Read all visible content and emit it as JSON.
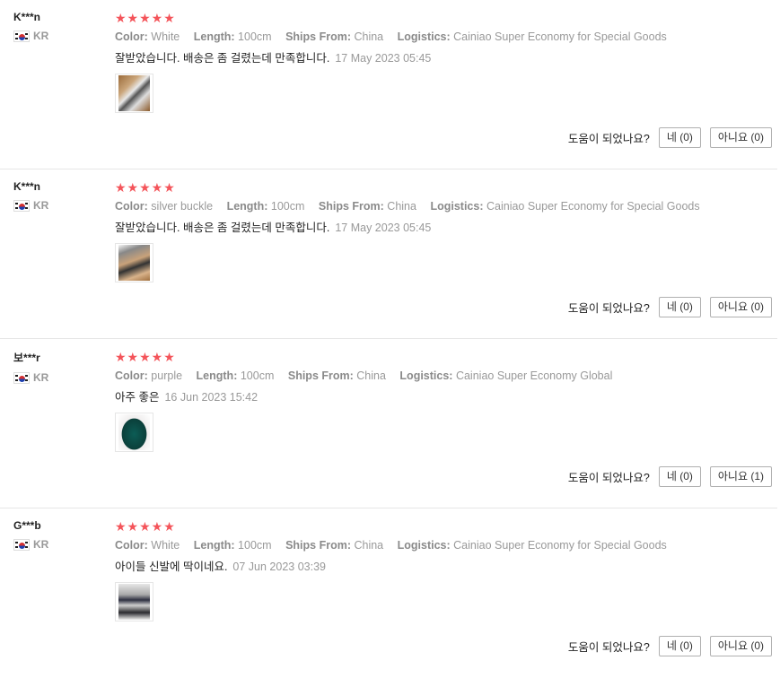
{
  "reviews": [
    {
      "user": "K***n",
      "country": "KR",
      "stars": "★★★★★",
      "attrs": [
        {
          "key": "Color:",
          "value": "White"
        },
        {
          "key": "Length:",
          "value": "100cm"
        },
        {
          "key": "Ships From:",
          "value": "China"
        },
        {
          "key": "Logistics:",
          "value": "Cainiao Super Economy for Special Goods"
        }
      ],
      "text": "잘받았습니다. 배송은 좀 걸렸는데 만족합니다.",
      "date": "17 May 2023 05:45",
      "helpful_q": "도움이 되었나요?",
      "yes": "네 (0)",
      "no": "아니요 (0)"
    },
    {
      "user": "K***n",
      "country": "KR",
      "stars": "★★★★★",
      "attrs": [
        {
          "key": "Color:",
          "value": "silver buckle"
        },
        {
          "key": "Length:",
          "value": "100cm"
        },
        {
          "key": "Ships From:",
          "value": "China"
        },
        {
          "key": "Logistics:",
          "value": "Cainiao Super Economy for Special Goods"
        }
      ],
      "text": "잘받았습니다. 배송은 좀 걸렸는데 만족합니다.",
      "date": "17 May 2023 05:45",
      "helpful_q": "도움이 되었나요?",
      "yes": "네 (0)",
      "no": "아니요 (0)"
    },
    {
      "user": "보***r",
      "country": "KR",
      "stars": "★★★★★",
      "attrs": [
        {
          "key": "Color:",
          "value": "purple"
        },
        {
          "key": "Length:",
          "value": "100cm"
        },
        {
          "key": "Ships From:",
          "value": "China"
        },
        {
          "key": "Logistics:",
          "value": "Cainiao Super Economy Global"
        }
      ],
      "text": "아주 좋은",
      "date": "16 Jun 2023 15:42",
      "helpful_q": "도움이 되었나요?",
      "yes": "네 (0)",
      "no": "아니요 (1)"
    },
    {
      "user": "G***b",
      "country": "KR",
      "stars": "★★★★★",
      "attrs": [
        {
          "key": "Color:",
          "value": "White"
        },
        {
          "key": "Length:",
          "value": "100cm"
        },
        {
          "key": "Ships From:",
          "value": "China"
        },
        {
          "key": "Logistics:",
          "value": "Cainiao Super Economy for Special Goods"
        }
      ],
      "text": "아이들 신발에 딱이네요.",
      "date": "07 Jun 2023 03:39",
      "helpful_q": "도움이 되었나요?",
      "yes": "네 (0)",
      "no": "아니요 (0)"
    }
  ],
  "colors": {
    "star": "#f4545a",
    "meta": "#999999",
    "divider": "#e6e6e6"
  },
  "icons": {
    "rating": "star-icon",
    "flag": "korea-flag-icon"
  }
}
